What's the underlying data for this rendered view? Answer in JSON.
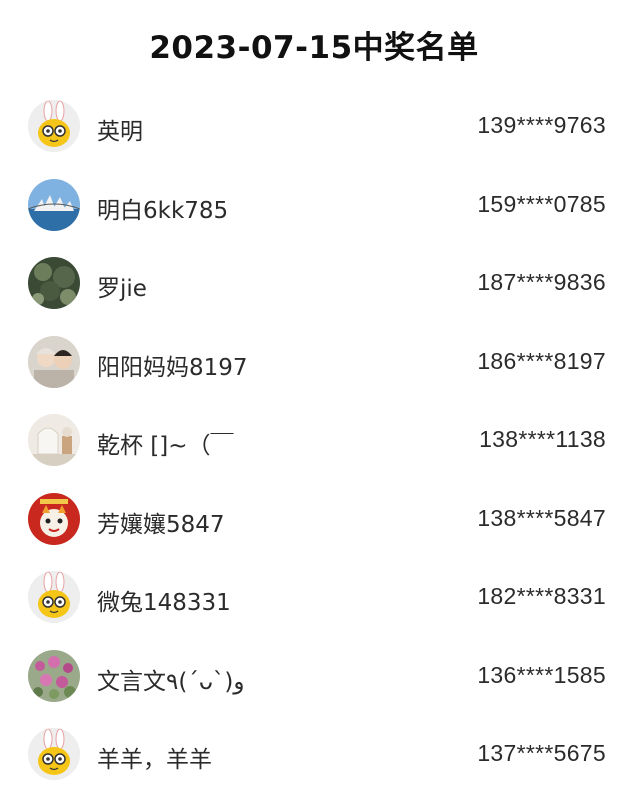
{
  "title": "2023-07-15中奖名单",
  "winners": [
    {
      "name": "英明",
      "phone": "139****9763",
      "avatar": "bunny-cartoon-avatar"
    },
    {
      "name": "明白6kk785",
      "phone": "159****0785",
      "avatar": "opera-house-photo-avatar"
    },
    {
      "name": "罗jie",
      "phone": "187****9836",
      "avatar": "tree-photo-avatar"
    },
    {
      "name": "阳阳妈妈8197",
      "phone": "186****8197",
      "avatar": "mother-child-photo-avatar"
    },
    {
      "name": "乾杯 []~（￣",
      "phone": "138****1138",
      "avatar": "room-interior-photo-avatar"
    },
    {
      "name": "芳孃孃5847",
      "phone": "138****5847",
      "avatar": "red-tiger-cartoon-avatar"
    },
    {
      "name": "微兔148331",
      "phone": "182****8331",
      "avatar": "bunny-cartoon-avatar"
    },
    {
      "name": "文言文٩(ˊᴗˋ)و",
      "phone": "136****1585",
      "avatar": "flowers-photo-avatar"
    },
    {
      "name": "羊羊，羊羊",
      "phone": "137****5675",
      "avatar": "bunny-cartoon-avatar"
    }
  ]
}
